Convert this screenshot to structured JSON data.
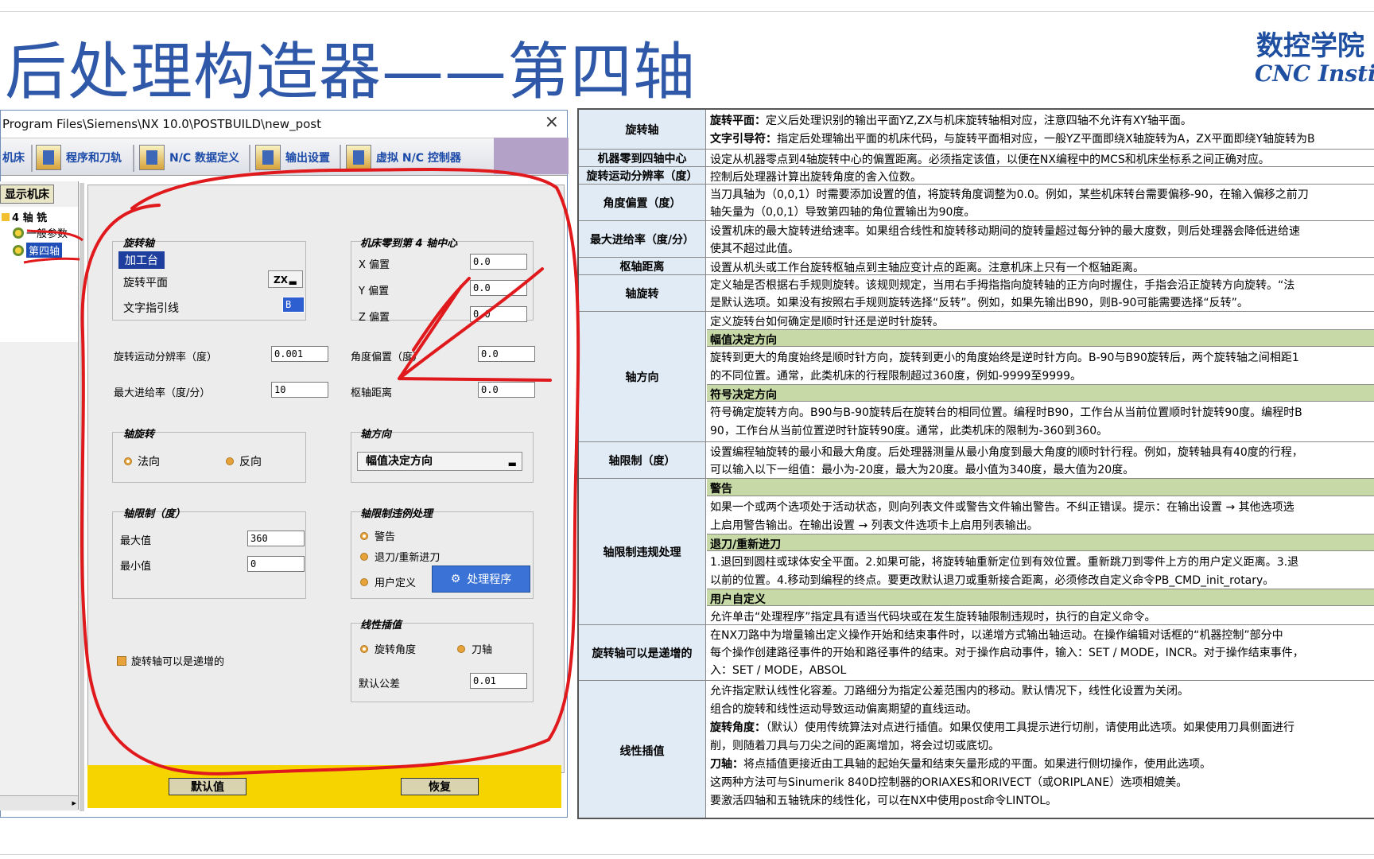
{
  "slide": {
    "title": "后处理构造器——第四轴",
    "logo_cn": "数控学院",
    "logo_en": "CNC Institute"
  },
  "dialog": {
    "path": "Program Files\\Siemens\\NX 10.0\\POSTBUILD\\new_post",
    "close": "×",
    "tabs": [
      "机床",
      "程序和刀轨",
      "N/C 数据定义",
      "输出设置",
      "虚拟 N/C 控制器"
    ],
    "show_machine": "显示机床",
    "tree": [
      "4 轴 铣",
      "一般参数",
      "第四轴"
    ],
    "rotary": {
      "title": "旋转轴",
      "tag": "加工台",
      "plane_label": "旋转平面",
      "plane_value": "ZX",
      "leader_label": "文字指引线",
      "leader_value": "B"
    },
    "origin": {
      "title": "机床零到第 4 轴中心",
      "x_label": "X 偏置",
      "x_value": "0.0",
      "y_label": "Y 偏置",
      "y_value": "0.0",
      "z_label": "Z 偏置",
      "z_value": "0.0"
    },
    "resolution_label": "旋转运动分辨率（度）",
    "resolution_value": "0.001",
    "angle_offset_label": "角度偏置（度）",
    "angle_offset_value": "0.0",
    "feed_label": "最大进给率（度/分）",
    "feed_value": "10",
    "pivot_label": "枢轴距离",
    "pivot_value": "0.0",
    "axis_rotation": {
      "title": "轴旋转",
      "normal": "法向",
      "reverse": "反向"
    },
    "axis_direction": {
      "title": "轴方向",
      "value": "幅值决定方向"
    },
    "axis_limits": {
      "title": "轴限制（度）",
      "max_label": "最大值",
      "max_value": "360",
      "min_label": "最小值",
      "min_value": "0"
    },
    "violation": {
      "title": "轴限制违例处理",
      "warn": "警告",
      "retract": "退刀/重新进刀",
      "user": "用户定义",
      "handler": "处理程序"
    },
    "linear": {
      "title": "线性插值",
      "angle": "旋转角度",
      "tool_axis": "刀轴",
      "tol_label": "默认公差",
      "tol_value": "0.01"
    },
    "incremental": "旋转轴可以是递增的",
    "defaults_btn": "默认值",
    "restore_btn": "恢复"
  },
  "table": {
    "rotary_axis": {
      "head": "旋转轴",
      "l1b": "旋转平面：",
      "l1": "定义后处理识别的输出平面YZ,ZX与机床旋转轴相对应，注意四轴不允许有XY轴平面。",
      "l2b": "文字引导符：",
      "l2": "指定后处理输出平面的机床代码，与旋转平面相对应，一般YZ平面即绕X轴旋转为A，ZX平面即绕Y轴旋转为B"
    },
    "zero_center": {
      "head": "机器零到四轴中心",
      "l1": "设定从机器零点到4轴旋转中心的偏置距离。必须指定该值，以便在NX编程中的MCS和机床坐标系之间正确对应。"
    },
    "resolution": {
      "head": "旋转运动分辨率（度）",
      "l1": "控制后处理器计算出旋转角度的舍入位数。"
    },
    "angle_offset": {
      "head": "角度偏置（度）",
      "l1": "当刀具轴为（0,0,1）时需要添加设置的值，将旋转角度调整为0.0。例如，某些机床转台需要偏移-90，在输入偏移之前刀",
      "l2": "轴矢量为（0,0,1）导致第四轴的角位置输出为90度。"
    },
    "max_feed": {
      "head": "最大进给率（度/分）",
      "l1": "设置机床的最大旋转进给速率。如果组合线性和旋转移动期间的旋转量超过每分钟的最大度数，则后处理器会降低进给速",
      "l2": "使其不超过此值。"
    },
    "pivot": {
      "head": "枢轴距离",
      "l1": "设置从机头或工作台旋转枢轴点到主轴应变计点的距离。注意机床上只有一个枢轴距离。"
    },
    "axis_rotation": {
      "head": "轴旋转",
      "l1": "定义轴是否根据右手规则旋转。该规则规定，当用右手拇指指向旋转轴的正方向时握住，手指会沿正旋转方向旋转。“法",
      "l2": "是默认选项。如果没有按照右手规则旋转选择“反转”。例如，如果先输出B90，则B-90可能需要选择“反转”。"
    },
    "axis_direction": {
      "head": "轴方向",
      "l1": "定义旋转台如何确定是顺时针还是逆时针旋转。",
      "g1": "幅值决定方向",
      "l2": "旋转到更大的角度始终是顺时针方向，旋转到更小的角度始终是逆时针方向。B-90与B90旋转后，两个旋转轴之间相距1",
      "l3": "的不同位置。通常，此类机床的行程限制超过360度，例如-9999至9999。",
      "g2": "符号决定方向",
      "l4": "符号确定旋转方向。B90与B-90旋转后在旋转台的相同位置。编程时B90，工作台从当前位置顺时针旋转90度。编程时B",
      "l5": "90，工作台从当前位置逆时针旋转90度。通常，此类机床的限制为-360到360。"
    },
    "axis_limits": {
      "head": "轴限制（度）",
      "l1": "设置编程轴旋转的最小和最大角度。后处理器测量从最小角度到最大角度的顺时针行程。例如，旋转轴具有40度的行程，",
      "l2": "可以输入以下一组值：最小为-20度，最大为20度。最小值为340度，最大值为20度。"
    },
    "violation": {
      "head": "轴限制违规处理",
      "g1": "警告",
      "l1": "如果一个或两个选项处于活动状态，则向列表文件或警告文件输出警告。不纠正错误。提示：在输出设置 → 其他选项选",
      "l2": "上启用警告输出。在输出设置 → 列表文件选项卡上启用列表输出。",
      "g2": "退刀/重新进刀",
      "l3": "1.退回到圆柱或球体安全平面。2.如果可能，将旋转轴重新定位到有效位置。重新跳刀到零件上方的用户定义距离。3.退",
      "l4": "以前的位置。4.移动到编程的终点。要更改默认退刀或重新接合距离，必须修改自定义命令PB_CMD_init_rotary。",
      "g3": "用户自定义",
      "l5": "允许单击“处理程序”指定具有适当代码块或在发生旋转轴限制违规时，执行的自定义命令。"
    },
    "incremental": {
      "head": "旋转轴可以是递增的",
      "l1": "在NX刀路中为增量输出定义操作开始和结束事件时，以递增方式输出轴运动。在操作编辑对话框的“机器控制”部分中",
      "l2": "每个操作创建路径事件的开始和路径事件的结束。对于操作启动事件，输入：SET / MODE，INCR。对于操作结束事件，",
      "l3": "入：SET / MODE，ABSOL"
    },
    "linear": {
      "head": "线性插值",
      "l1": "允许指定默认线性化容差。刀路细分为指定公差范围内的移动。默认情况下，线性化设置为关闭。",
      "l2": "组合的旋转和线性运动导致运动偏离期望的直线运动。",
      "l3b": "旋转角度：",
      "l3": "（默认）使用传统算法对点进行插值。如果仅使用工具提示进行切削，请使用此选项。如果使用刀具侧面进行",
      "l4": "削，则随着刀具与刀尖之间的距离增加，将会过切或底切。",
      "l5b": "刀轴：",
      "l5": "将点插值更接近由工具轴的起始矢量和结束矢量形成的平面。如果进行侧切操作，使用此选项。",
      "l6": "这两种方法可与Sinumerik 840D控制器的ORIAXES和ORIVECT（或ORIPLANE）选项相媲美。",
      "l7": "要激活四轴和五轴铣床的线性化，可以在NX中使用post命令LINTOL。"
    }
  },
  "colors": {
    "title_blue": "#2f58a8",
    "annotation_red": "#e0191c",
    "header_cell": "#e0ebf6",
    "green_band": "#c6d9a7",
    "button_yellow": "#f5d400"
  }
}
